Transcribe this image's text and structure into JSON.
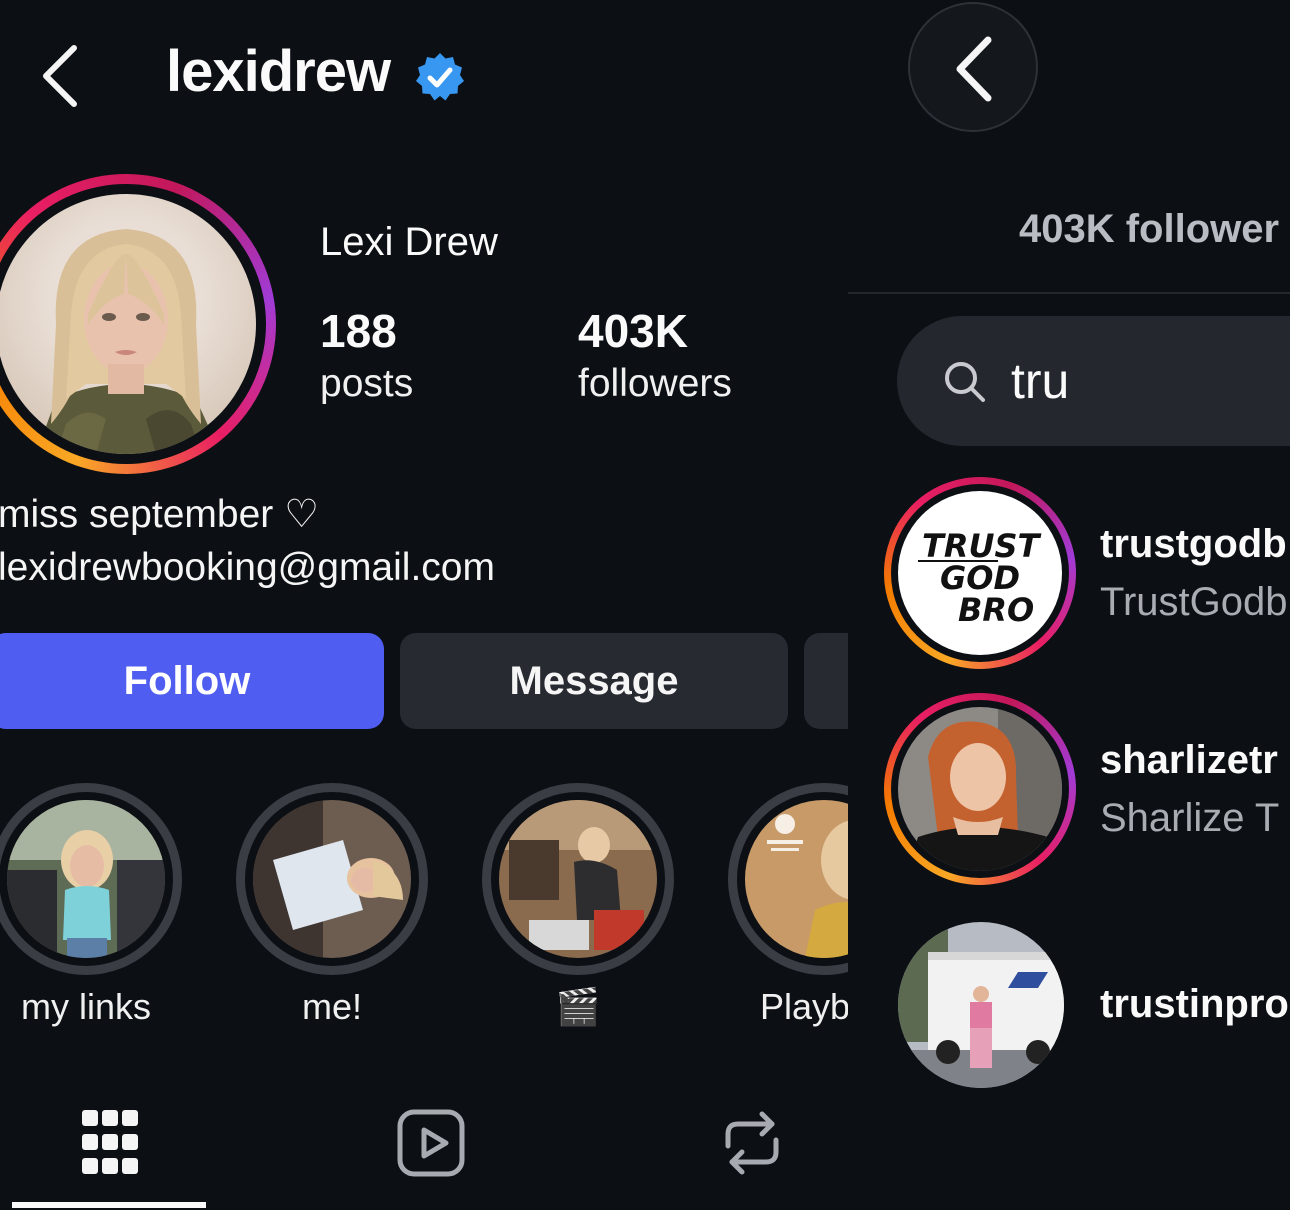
{
  "profile": {
    "username": "lexidrew",
    "display_name": "Lexi Drew",
    "stats": {
      "posts_count": "188",
      "posts_label": "posts",
      "followers_count": "403K",
      "followers_label": "followers"
    },
    "bio": {
      "line1": "miss september ♡",
      "line2": "lexidrewbooking@gmail.com"
    },
    "actions": {
      "follow_label": "Follow",
      "message_label": "Message"
    },
    "highlights": [
      {
        "label": "my links"
      },
      {
        "label": "me!"
      },
      {
        "label": "🎬"
      },
      {
        "label": "Playb"
      }
    ],
    "tabs": [
      "grid-icon",
      "reels-icon",
      "reposts-icon"
    ]
  },
  "followers_search": {
    "header_followers": "403K follower",
    "query": "tru",
    "results": [
      {
        "username": "trustgodb",
        "full_name": "TrustGodb",
        "avatar_text": [
          "TRUST",
          "GOD",
          "BRO"
        ]
      },
      {
        "username": "sharlizetr",
        "full_name": "Sharlize T"
      },
      {
        "username": "trustinpro",
        "full_name": ""
      }
    ]
  },
  "colors": {
    "background": "#0c0f14",
    "follow_button": "#4f5ef0",
    "secondary_button": "#272a31",
    "verified_badge": "#3897f0",
    "muted_text": "#a9acb2"
  }
}
